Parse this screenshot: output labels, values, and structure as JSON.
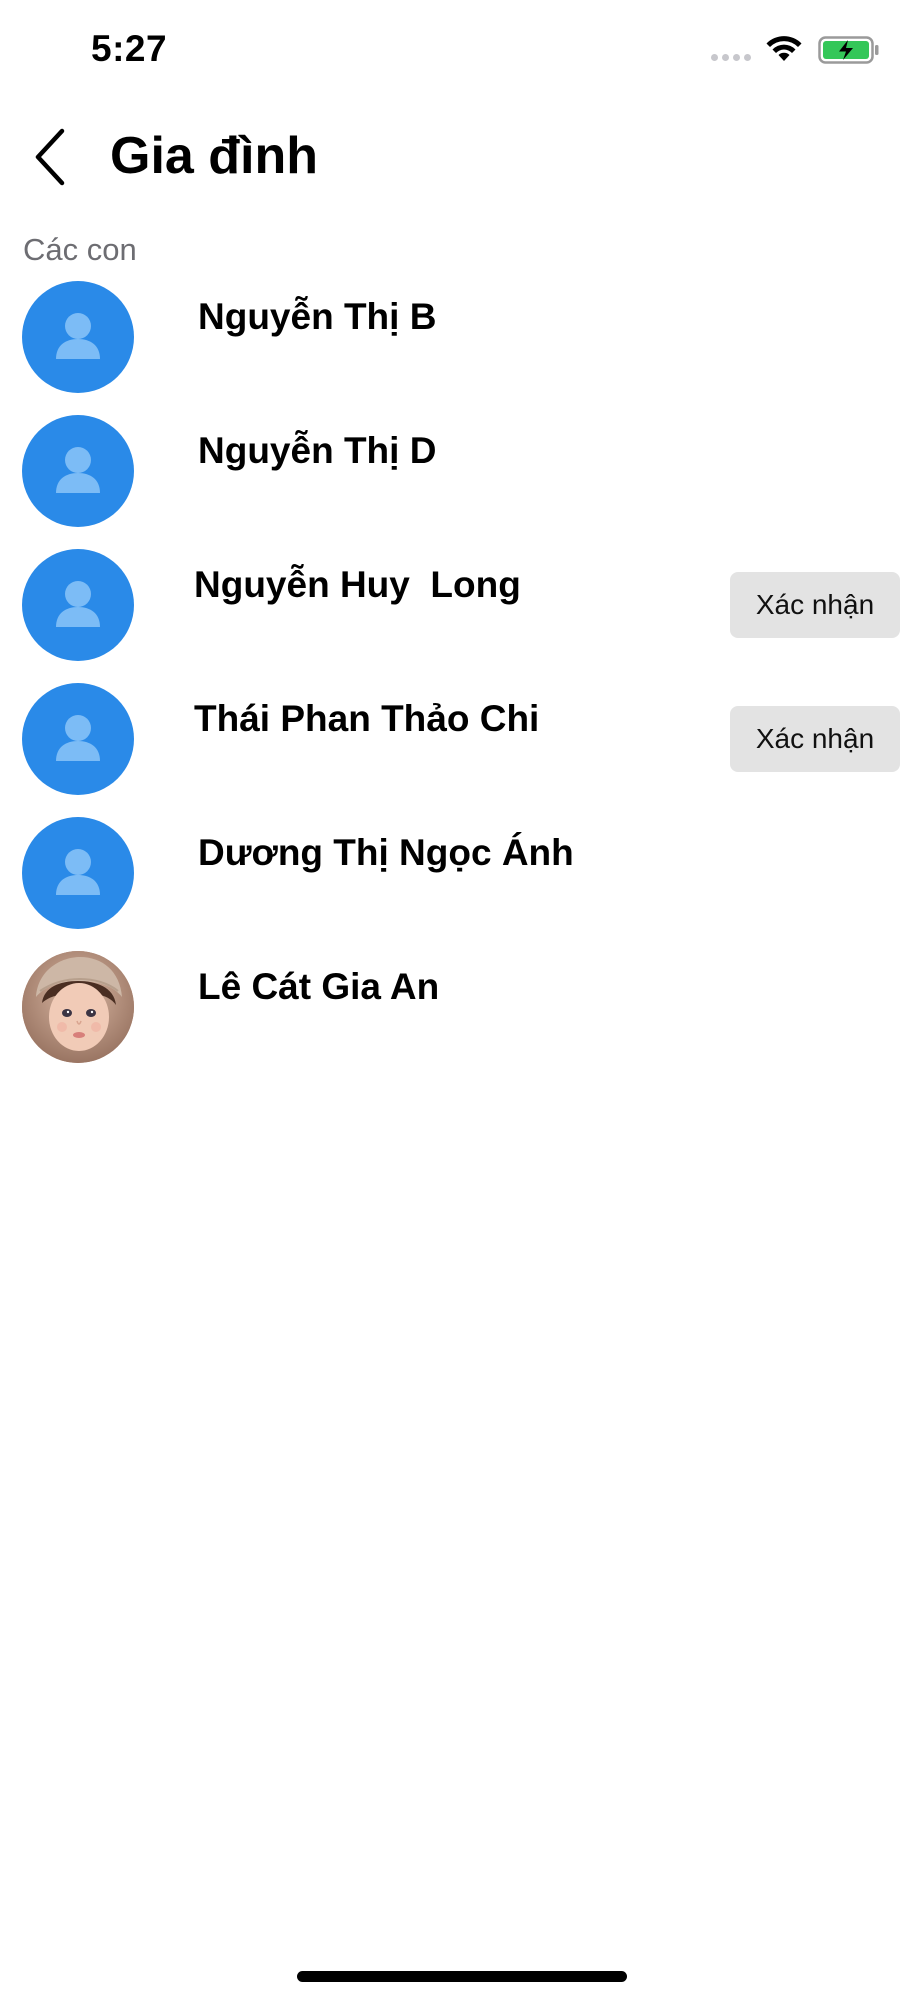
{
  "status_bar": {
    "time": "5:27",
    "wifi_icon": "wifi-icon",
    "battery_icon": "battery-charging-icon",
    "battery_color": "#34c759"
  },
  "header": {
    "back_icon": "chevron-left-icon",
    "title": "Gia đình"
  },
  "section": {
    "label": "Các con"
  },
  "children": [
    {
      "name": "Nguyễn Thị B",
      "avatar": "default-user-icon",
      "action": ""
    },
    {
      "name": "Nguyễn Thị D",
      "avatar": "default-user-icon",
      "action": ""
    },
    {
      "name": "Nguyễn Huy  Long",
      "avatar": "default-user-icon",
      "action": "Xác nhận"
    },
    {
      "name": "Thái Phan Thảo Chi",
      "avatar": "default-user-icon",
      "action": "Xác nhận"
    },
    {
      "name": "Dương Thị Ngọc Ánh",
      "avatar": "default-user-icon",
      "action": ""
    },
    {
      "name": "Lê Cát Gia An",
      "avatar": "child-photo",
      "action": ""
    }
  ],
  "colors": {
    "avatar_blue": "#2a8ae8",
    "button_gray": "#e3e3e3",
    "section_label": "#6d6d72"
  }
}
